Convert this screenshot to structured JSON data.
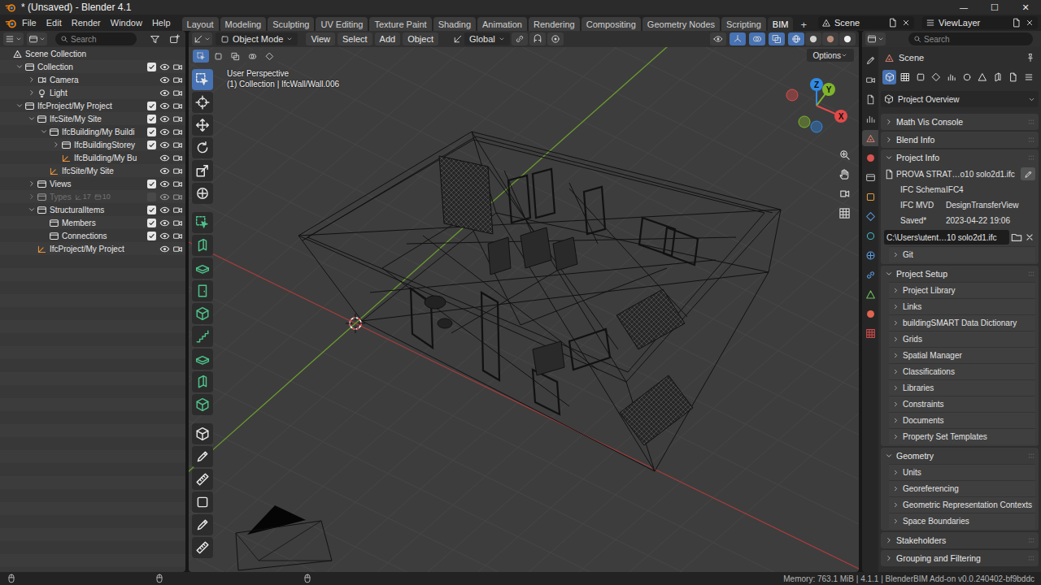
{
  "window": {
    "title": "* (Unsaved) - Blender 4.1",
    "controls": [
      "—",
      "☐",
      "✕"
    ]
  },
  "menu": [
    "File",
    "Edit",
    "Render",
    "Window",
    "Help"
  ],
  "workspaces": [
    {
      "label": "Layout",
      "selected": false
    },
    {
      "label": "Modeling",
      "selected": false
    },
    {
      "label": "Sculpting",
      "selected": false
    },
    {
      "label": "UV Editing",
      "selected": false
    },
    {
      "label": "Texture Paint",
      "selected": false
    },
    {
      "label": "Shading",
      "selected": false
    },
    {
      "label": "Animation",
      "selected": false
    },
    {
      "label": "Rendering",
      "selected": false
    },
    {
      "label": "Compositing",
      "selected": false
    },
    {
      "label": "Geometry Nodes",
      "selected": false
    },
    {
      "label": "Scripting",
      "selected": false
    },
    {
      "label": "BIM",
      "selected": true
    }
  ],
  "add_workspace": "+",
  "scene_selector": {
    "value": "Scene"
  },
  "view_layer_selector": {
    "value": "ViewLayer"
  },
  "outliner": {
    "search": {
      "placeholder": "Search"
    },
    "tree": [
      {
        "label": "Scene Collection",
        "kind": "scene",
        "expandable": false,
        "expanded": true,
        "children": [
          {
            "label": "Collection",
            "kind": "collection",
            "expandable": true,
            "expanded": true,
            "checked": true,
            "visible": true,
            "renderable": true,
            "greyed": false,
            "children": [
              {
                "label": "Camera",
                "kind": "camera",
                "expandable": true,
                "expanded": false,
                "visible": true,
                "renderable": true,
                "greyed": false
              },
              {
                "label": "Light",
                "kind": "light",
                "expandable": true,
                "expanded": false,
                "visible": true,
                "renderable": true,
                "greyed": false
              }
            ]
          },
          {
            "label": "IfcProject/My Project",
            "kind": "collection",
            "expandable": true,
            "expanded": true,
            "checked": true,
            "visible": true,
            "renderable": true,
            "greyed": false,
            "children": [
              {
                "label": "IfcSite/My Site",
                "kind": "collection",
                "expandable": true,
                "expanded": true,
                "checked": true,
                "visible": true,
                "renderable": true,
                "greyed": false,
                "children": [
                  {
                    "label": "IfcBuilding/My Buildi",
                    "kind": "collection",
                    "expandable": true,
                    "expanded": true,
                    "checked": true,
                    "visible": true,
                    "renderable": true,
                    "greyed": false,
                    "children": [
                      {
                        "label": "IfcBuildingStorey",
                        "kind": "collection",
                        "expandable": true,
                        "expanded": false,
                        "checked": true,
                        "visible": true,
                        "renderable": true,
                        "greyed": false
                      },
                      {
                        "label": "IfcBuilding/My Bu",
                        "kind": "empty",
                        "expandable": false,
                        "expanded": false,
                        "visible": true,
                        "renderable": true,
                        "greyed": false
                      }
                    ]
                  },
                  {
                    "label": "IfcSite/My Site",
                    "kind": "empty",
                    "expandable": false,
                    "expanded": false,
                    "visible": true,
                    "renderable": true,
                    "greyed": false
                  }
                ]
              },
              {
                "label": "Views",
                "kind": "collection",
                "expandable": true,
                "expanded": false,
                "checked": true,
                "visible": true,
                "renderable": true,
                "greyed": false
              },
              {
                "label": "Types",
                "kind": "collection",
                "expandable": true,
                "expanded": false,
                "checked": false,
                "visible": true,
                "renderable": true,
                "greyed": true,
                "badges": [
                  "17",
                  "10"
                ]
              },
              {
                "label": "StructuralItems",
                "kind": "collection",
                "expandable": true,
                "expanded": true,
                "checked": true,
                "visible": true,
                "renderable": true,
                "greyed": false,
                "children": [
                  {
                    "label": "Members",
                    "kind": "collection",
                    "expandable": false,
                    "expanded": false,
                    "checked": true,
                    "visible": true,
                    "renderable": true,
                    "greyed": false
                  },
                  {
                    "label": "Connections",
                    "kind": "collection",
                    "expandable": false,
                    "expanded": false,
                    "checked": true,
                    "visible": true,
                    "renderable": true,
                    "greyed": false
                  }
                ]
              },
              {
                "label": "IfcProject/My Project",
                "kind": "empty",
                "expandable": false,
                "expanded": false,
                "visible": true,
                "renderable": true,
                "greyed": false
              }
            ]
          }
        ]
      }
    ]
  },
  "viewport": {
    "mode": "Object Mode",
    "menus": [
      "View",
      "Select",
      "Add",
      "Object"
    ],
    "orientation": "Global",
    "options": "Options",
    "overlay": [
      "User Perspective",
      "(1) Collection | IfcWall/Wall.006"
    ],
    "toggles": [
      {
        "on": false
      },
      {
        "on": true
      },
      {
        "on": true
      },
      {
        "on": true
      }
    ],
    "shading": [
      {
        "selected": true
      },
      {
        "selected": false
      },
      {
        "selected": false
      },
      {
        "selected": false
      }
    ],
    "gizmo": [
      {
        "label": "Z",
        "color": "#2f8ae6"
      },
      {
        "label": "Y",
        "color": "#7fb52c"
      },
      {
        "label": "X",
        "color": "#e24a4a"
      }
    ],
    "tools": [
      {
        "kind": "tool",
        "selected": true
      },
      {
        "kind": "tool",
        "selected": false
      },
      {
        "kind": "tool",
        "selected": false
      },
      {
        "kind": "tool",
        "selected": false
      },
      {
        "kind": "tool",
        "selected": false
      },
      {
        "kind": "tool",
        "selected": false
      },
      {
        "kind": "bim",
        "selected": false
      },
      {
        "kind": "bim",
        "selected": false
      },
      {
        "kind": "bim",
        "selected": false
      },
      {
        "kind": "bim",
        "selected": false
      },
      {
        "kind": "bim",
        "selected": false
      },
      {
        "kind": "bim",
        "selected": false
      },
      {
        "kind": "bim",
        "selected": false
      },
      {
        "kind": "bim",
        "selected": false
      },
      {
        "kind": "bim",
        "selected": false
      },
      {
        "kind": "tool",
        "selected": false
      },
      {
        "kind": "tool",
        "selected": false
      },
      {
        "kind": "tool",
        "selected": false
      },
      {
        "kind": "tool",
        "selected": false
      },
      {
        "kind": "tool",
        "selected": false
      },
      {
        "kind": "tool",
        "selected": false
      }
    ]
  },
  "properties": {
    "search": {
      "placeholder": "Search"
    },
    "tabs": [
      {
        "selected": false,
        "color": "#b8b8b8"
      },
      {
        "selected": false,
        "color": "#b8b8b8"
      },
      {
        "selected": false,
        "color": "#b8b8b8"
      },
      {
        "selected": false,
        "color": "#b8b8b8"
      },
      {
        "selected": true,
        "color": "#d07a6a"
      },
      {
        "selected": false,
        "color": "#d9534f"
      },
      {
        "selected": false,
        "color": "#b8b8b8"
      },
      {
        "selected": false,
        "color": "#e39b3c"
      },
      {
        "selected": false,
        "color": "#5c9ee6"
      },
      {
        "selected": false,
        "color": "#3fb8c6"
      },
      {
        "selected": false,
        "color": "#5c9ee6"
      },
      {
        "selected": false,
        "color": "#5c9ee6"
      },
      {
        "selected": false,
        "color": "#6dbf5b"
      },
      {
        "selected": false,
        "color": "#e0654f"
      },
      {
        "selected": false,
        "color": "#c94a4a"
      }
    ],
    "context": "Scene",
    "bim_tabs": [
      {
        "selected": true
      },
      {
        "selected": false
      },
      {
        "selected": false
      },
      {
        "selected": false
      },
      {
        "selected": false
      },
      {
        "selected": false
      },
      {
        "selected": false
      },
      {
        "selected": false
      },
      {
        "selected": false
      },
      {
        "selected": false
      }
    ],
    "dropdown": "Project Overview",
    "panels": [
      {
        "title": "Math Vis Console",
        "expanded": false
      },
      {
        "title": "Blend Info",
        "expanded": false
      },
      {
        "title": "Project Info",
        "expanded": true,
        "file": "PROVA STRAT…o10 solo2d1.ifc",
        "fields": [
          {
            "label": "IFC Schema",
            "value": "IFC4"
          },
          {
            "label": "IFC MVD",
            "value": "DesignTransferView"
          },
          {
            "label": "Saved*",
            "value": "2023-04-22 19:06"
          }
        ],
        "path": "C:\\Users\\utent…10 solo2d1.ifc",
        "subpanels": [
          {
            "title": "Git",
            "expanded": false
          }
        ]
      },
      {
        "title": "Project Setup",
        "expanded": true,
        "subpanels": [
          {
            "title": "Project Library",
            "expanded": false
          },
          {
            "title": "Links",
            "expanded": false
          },
          {
            "title": "buildingSMART Data Dictionary",
            "expanded": false
          },
          {
            "title": "Grids",
            "expanded": false
          },
          {
            "title": "Spatial Manager",
            "expanded": false
          },
          {
            "title": "Classifications",
            "expanded": false
          },
          {
            "title": "Libraries",
            "expanded": false
          },
          {
            "title": "Constraints",
            "expanded": false
          },
          {
            "title": "Documents",
            "expanded": false
          },
          {
            "title": "Property Set Templates",
            "expanded": false
          }
        ]
      },
      {
        "title": "Geometry",
        "expanded": true,
        "subpanels": [
          {
            "title": "Units",
            "expanded": false
          },
          {
            "title": "Georeferencing",
            "expanded": false
          },
          {
            "title": "Geometric Representation Contexts",
            "expanded": false
          },
          {
            "title": "Space Boundaries",
            "expanded": false
          }
        ]
      },
      {
        "title": "Stakeholders",
        "expanded": false
      },
      {
        "title": "Grouping and Filtering",
        "expanded": false
      }
    ]
  },
  "status_bar": {
    "text": "Memory: 763.1 MiB | 4.1.1 | BlenderBIM Add-on v0.0.240402-bf9bddc"
  }
}
